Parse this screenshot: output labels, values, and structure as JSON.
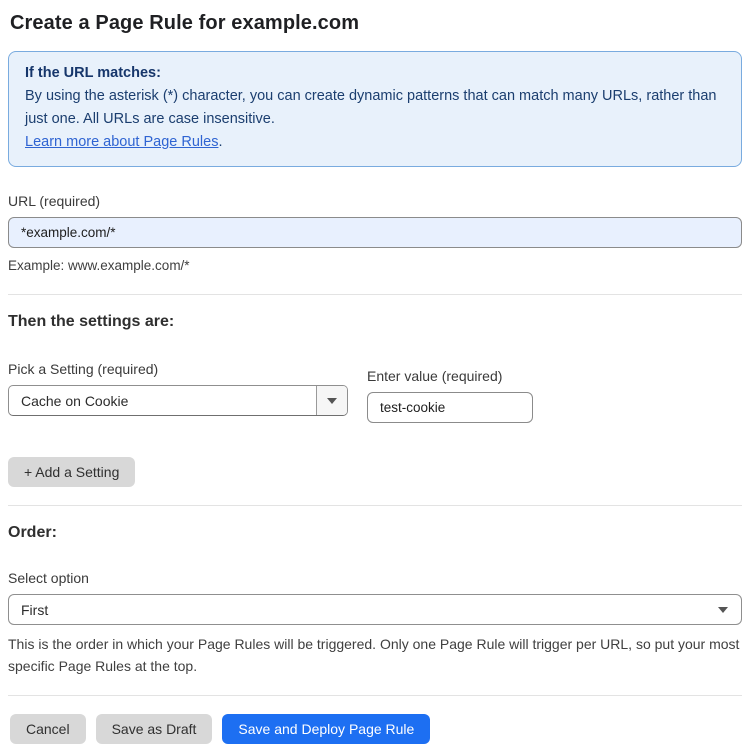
{
  "page": {
    "title": "Create a Page Rule for example.com"
  },
  "info_box": {
    "heading": "If the URL matches:",
    "body": "By using the asterisk (*) character, you can create dynamic patterns that can match many URLs, rather than just one. All URLs are case insensitive.",
    "link_label": "Learn more about Page Rules",
    "link_suffix": "."
  },
  "url_field": {
    "label": "URL (required)",
    "value": "*example.com/*",
    "helper": "Example: www.example.com/*"
  },
  "settings": {
    "heading": "Then the settings are:",
    "setting_label": "Pick a Setting (required)",
    "setting_selected": "Cache on Cookie",
    "value_label": "Enter value (required)",
    "value_text": "test-cookie",
    "add_button_label": "+ Add a Setting"
  },
  "order": {
    "heading": "Order:",
    "select_label": "Select option",
    "selected": "First",
    "helper": "This is the order in which your Page Rules will be triggered. Only one Page Rule will trigger per URL, so put your most specific Page Rules at the top."
  },
  "footer": {
    "cancel_label": "Cancel",
    "save_draft_label": "Save as Draft",
    "save_deploy_label": "Save and Deploy Page Rule"
  },
  "colors": {
    "accent_blue": "#1d6ff2",
    "info_background": "#e8f1fb",
    "info_border": "#79abdf",
    "info_text": "#1b3e6f",
    "link_blue": "#2f64d2",
    "url_autofill_background": "#e8f0fe",
    "button_gray": "#d8d8d8"
  }
}
